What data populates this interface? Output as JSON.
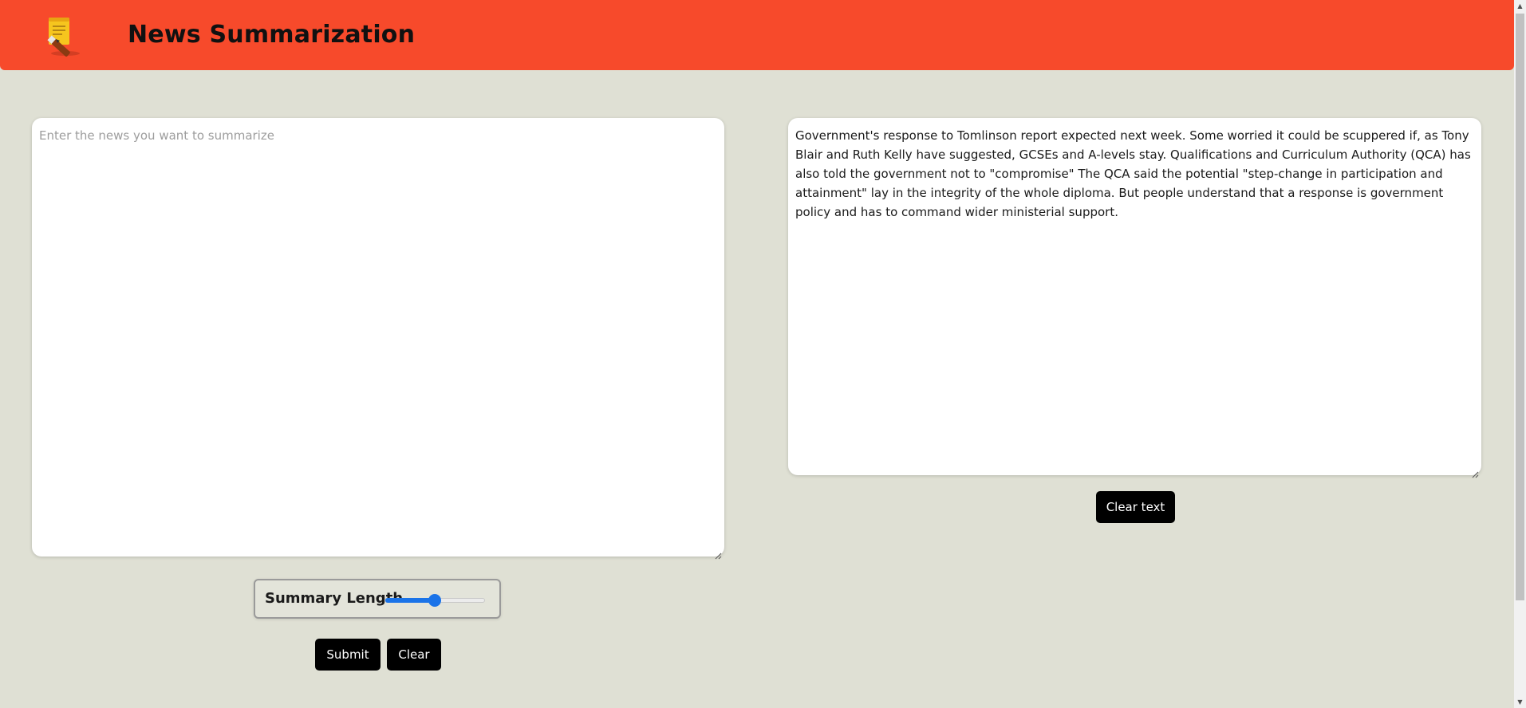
{
  "header": {
    "title": "News Summarization",
    "logo_icon": "note-pencil-icon",
    "background_color": "#f74a2b"
  },
  "input": {
    "placeholder": "Enter the news you want to summarize",
    "value": ""
  },
  "slider": {
    "label": "Summary Length",
    "value_fraction": 0.5,
    "accent_color": "#1a73e8"
  },
  "buttons": {
    "submit_label": "Submit",
    "clear_label": "Clear",
    "clear_text_label": "Clear text"
  },
  "output": {
    "text": "Government's response to Tomlinson report expected next week. Some worried it could be scuppered if, as Tony Blair and Ruth Kelly have suggested, GCSEs and A-levels stay. Qualifications and Curriculum Authority (QCA) has also told the government not to \"compromise\" The QCA said the potential \"step-change in participation and attainment\" lay in the integrity of the whole diploma. But people understand that a response is government policy and has to command wider ministerial support."
  },
  "page": {
    "background_color": "#dfe0d4"
  }
}
